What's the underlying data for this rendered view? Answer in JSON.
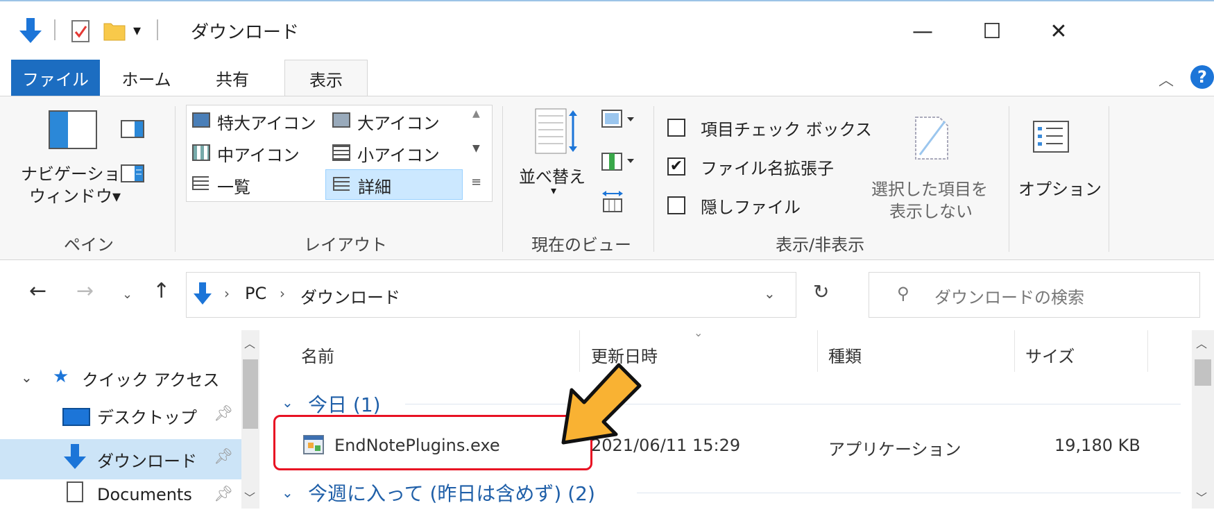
{
  "window": {
    "title": "ダウンロード",
    "controls": {
      "minimize": "—",
      "maximize": "☐",
      "close": "✕"
    }
  },
  "tabs": [
    {
      "label": "ファイル"
    },
    {
      "label": "ホーム"
    },
    {
      "label": "共有"
    },
    {
      "label": "表示"
    }
  ],
  "ribbon": {
    "pane": {
      "nav_label_1": "ナビゲーション",
      "nav_label_2": "ウィンドウ▾",
      "group": "ペイン"
    },
    "layout": {
      "items": [
        "特大アイコン",
        "大アイコン",
        "中アイコン",
        "小アイコン",
        "一覧",
        "詳細"
      ],
      "group": "レイアウト"
    },
    "current_view": {
      "sort": "並べ替え",
      "group": "現在のビュー"
    },
    "show_hide": {
      "checkbox_items": {
        "label": "項目チェック ボックス",
        "checked": false
      },
      "checkbox_ext": {
        "label": "ファイル名拡張子",
        "checked": true
      },
      "checkbox_hidden": {
        "label": "隠しファイル",
        "checked": false
      },
      "hide_selected_1": "選択した項目を",
      "hide_selected_2": "表示しない",
      "group": "表示/非表示"
    },
    "options": "オプション"
  },
  "address": {
    "crumbs": [
      "PC",
      "ダウンロード"
    ],
    "search_placeholder": "ダウンロードの検索"
  },
  "nav": {
    "quick_access": "クイック アクセス",
    "items": [
      "デスクトップ",
      "ダウンロード",
      "Documents"
    ]
  },
  "list": {
    "columns": [
      "名前",
      "更新日時",
      "種類",
      "サイズ"
    ],
    "groups": [
      {
        "label": "今日 (1)"
      },
      {
        "label": "今週に入って (昨日は含めず) (2)"
      }
    ],
    "rows": [
      {
        "name": "EndNotePlugins.exe",
        "date": "2021/06/11 15:29",
        "type": "アプリケーション",
        "size": "19,180 KB"
      }
    ]
  },
  "colors": {
    "accent": "#1c6dc1",
    "highlight": "#e81123",
    "arrow": "#f9b233"
  }
}
